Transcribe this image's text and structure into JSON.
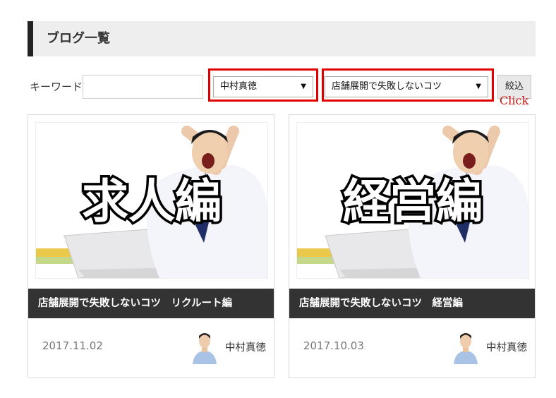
{
  "header": {
    "title": "ブログ一覧"
  },
  "filters": {
    "keyword_label": "キーワード",
    "keyword_value": "",
    "author_selected": "中村真徳",
    "category_selected": "店舗展開で失敗しないコツ",
    "submit_label": "絞込",
    "annotation": "Click",
    "annotation_color": "#e00000"
  },
  "posts": [
    {
      "thumb_text": "求人編",
      "title": "店舗展開で失敗しないコツ　リクルート編",
      "date": "2017.11.02",
      "author": "中村真徳"
    },
    {
      "thumb_text": "経営編",
      "title": "店舗展開で失敗しないコツ　経営編",
      "date": "2017.10.03",
      "author": "中村真徳"
    }
  ]
}
